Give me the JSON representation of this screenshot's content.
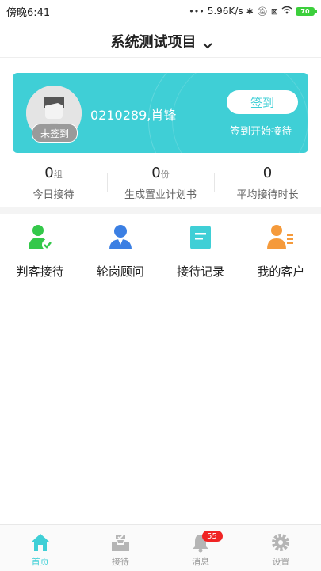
{
  "status_bar": {
    "time": "傍晚6:41",
    "network_speed": "5.96K/s",
    "icons": [
      "dots-icon",
      "bluetooth-icon",
      "mute-icon",
      "sim-icon",
      "wifi-icon",
      "battery-icon"
    ],
    "battery_level": "70"
  },
  "header": {
    "title": "系统测试项目"
  },
  "profile_card": {
    "status_badge": "未签到",
    "user_name": "0210289,肖锋",
    "signin_button": "签到",
    "signin_hint": "签到开始接待",
    "accent_color": "#3fcfd6"
  },
  "stats": [
    {
      "value": "0",
      "unit": "组",
      "label": "今日接待"
    },
    {
      "value": "0",
      "unit": "份",
      "label": "生成置业计划书"
    },
    {
      "value": "0",
      "unit": "",
      "label": "平均接待时长"
    }
  ],
  "actions": [
    {
      "label": "判客接待",
      "icon": "person-check-icon",
      "color": "#34c84a"
    },
    {
      "label": "轮岗顾问",
      "icon": "advisor-icon",
      "color": "#3b7fe3"
    },
    {
      "label": "接待记录",
      "icon": "document-icon",
      "color": "#3fcfd6"
    },
    {
      "label": "我的客户",
      "icon": "customer-list-icon",
      "color": "#f59a3b"
    }
  ],
  "tabbar": {
    "tabs": [
      {
        "label": "首页",
        "icon": "home-icon"
      },
      {
        "label": "接待",
        "icon": "inbox-icon"
      },
      {
        "label": "消息",
        "icon": "bell-icon"
      },
      {
        "label": "设置",
        "icon": "gear-icon"
      }
    ],
    "active_tab": "首页",
    "message_badge": "55"
  }
}
